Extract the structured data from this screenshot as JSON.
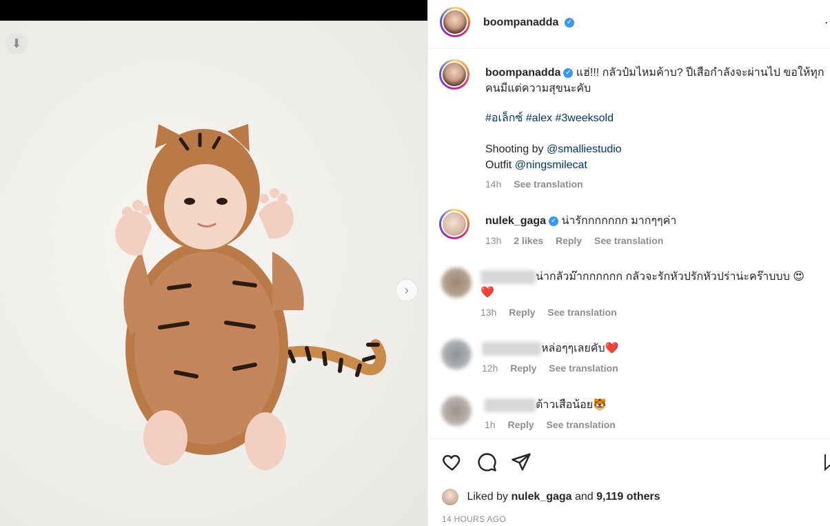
{
  "post": {
    "username": "boompanadda",
    "caption": "แฮ่!!! กลัวป๋มไหมค้าบ? ปีเสือกำลังจะผ่านไป ขอให้ทุกคนมีแต่ความสุขนะคับ",
    "hashtags": [
      "#อเล็กซ์",
      "#alex",
      "#3weeksold"
    ],
    "credit_line1_prefix": "Shooting by",
    "credit_line1_mention": "@smalliestudio",
    "credit_line2_prefix": "Outfit",
    "credit_line2_mention": "@ningsmilecat",
    "time": "14h",
    "see_translation": "See translation"
  },
  "comments": [
    {
      "username": "nulek_gaga",
      "text": "น่ารักกกกกกก มากๆๆค่า",
      "time": "13h",
      "likes": "2 likes",
      "reply": "Reply",
      "see_translation": "See translation"
    },
    {
      "username": "",
      "text": "น่ากลัวม๊ากกกกกก กลัวจะรักหัวปรักหัวปร่าน่ะคร๊าบบบ 😍",
      "text2": "❤️",
      "time": "13h",
      "reply": "Reply",
      "see_translation": "See translation"
    },
    {
      "username": "",
      "text": "หล่อๆๆเลยคับ❤️",
      "time": "12h",
      "reply": "Reply",
      "see_translation": "See translation"
    },
    {
      "username": "",
      "text": "ต้าวเสือน้อย🐯",
      "time": "1h",
      "reply": "Reply",
      "see_translation": "See translation"
    }
  ],
  "footer": {
    "liked_by_prefix": "Liked by",
    "liked_by_user": "nulek_gaga",
    "liked_by_and": "and",
    "liked_by_count": "9,119 others",
    "timestamp": "14 HOURS AGO"
  },
  "icons": {
    "download": "arrow-down-icon",
    "next": "chevron-right-icon",
    "more": "ellipsis-icon",
    "verified": "verified-badge-icon",
    "like": "heart-icon",
    "comment": "comment-icon",
    "share": "paper-plane-icon",
    "save": "bookmark-icon"
  },
  "colors": {
    "verified": "#3897f0",
    "link": "#00376b",
    "muted": "#8e8e8e"
  }
}
